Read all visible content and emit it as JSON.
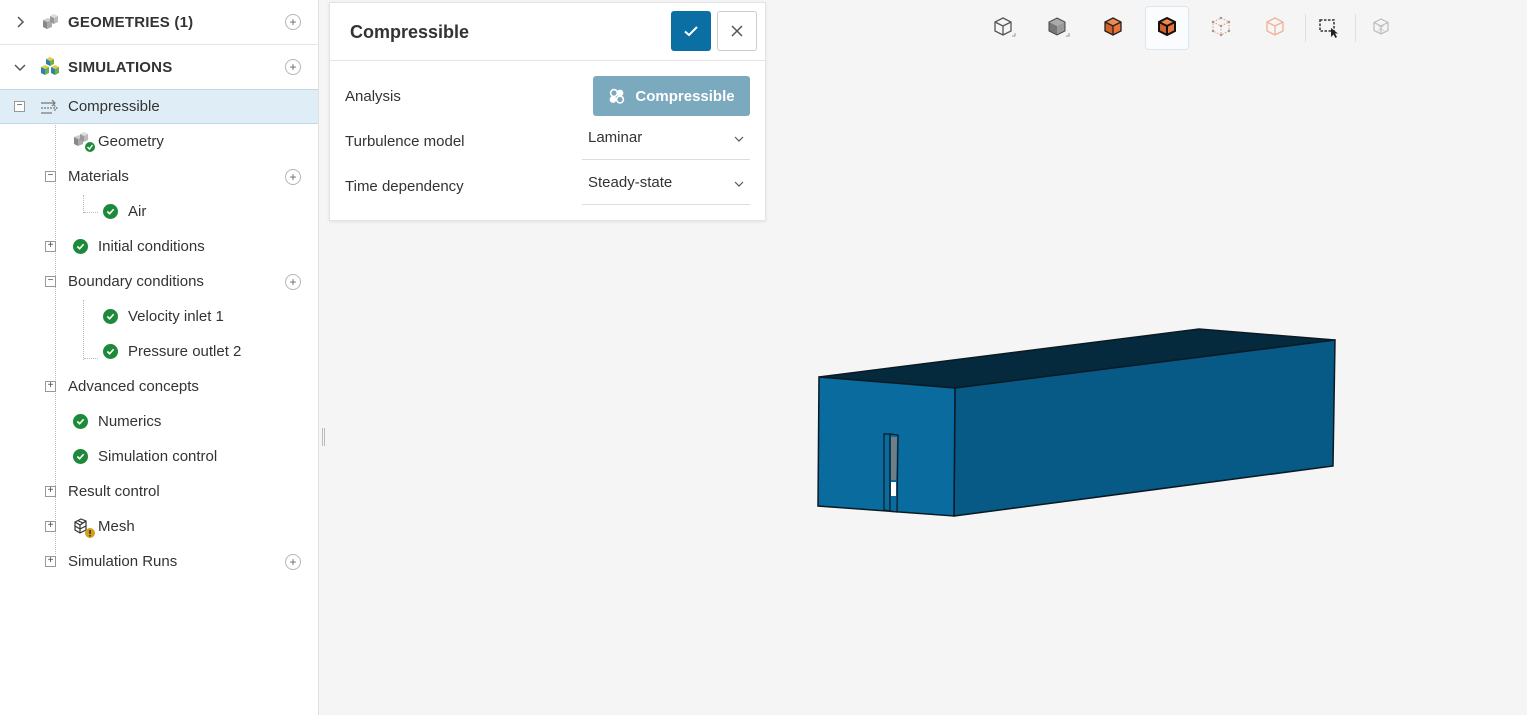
{
  "sidebar": {
    "geometries_label": "GEOMETRIES (1)",
    "simulations_label": "SIMULATIONS",
    "tree": {
      "compressible": "Compressible",
      "geometry": "Geometry",
      "materials": "Materials",
      "air": "Air",
      "initial_conditions": "Initial conditions",
      "boundary_conditions": "Boundary conditions",
      "velocity_inlet": "Velocity inlet 1",
      "pressure_outlet": "Pressure outlet 2",
      "advanced_concepts": "Advanced concepts",
      "numerics": "Numerics",
      "simulation_control": "Simulation control",
      "result_control": "Result control",
      "mesh": "Mesh",
      "simulation_runs": "Simulation Runs"
    },
    "plus_symbol": "+",
    "expand_symbol": "+",
    "collapse_symbol": "−"
  },
  "panel": {
    "title": "Compressible",
    "analysis_label": "Analysis",
    "analysis_value": "Compressible",
    "turbulence_label": "Turbulence model",
    "turbulence_value": "Laminar",
    "time_label": "Time dependency",
    "time_value": "Steady-state"
  },
  "toolbar": {
    "icons": [
      "wireframe-cube-icon",
      "solid-cube-icon",
      "orange-solid-cube-icon",
      "orange-edges-cube-icon",
      "dotted-cube-icon",
      "outline-orange-cube-icon",
      "box-select-icon",
      "hidden-cube-icon"
    ]
  },
  "colors": {
    "accent": "#0b6fa4",
    "success": "#1d8a3a",
    "model_front": "#0a6b9e",
    "model_side": "#075a85",
    "model_top": "#062a3d",
    "selected_row": "#dfeef6"
  }
}
